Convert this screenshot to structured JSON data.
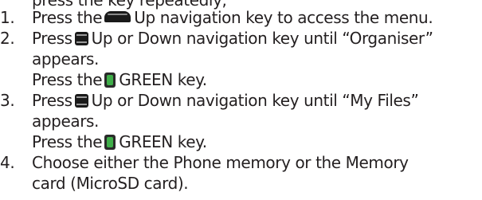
{
  "cut_off_line": "press the key repeatedly,",
  "steps": [
    {
      "number": "1.",
      "lines": [
        {
          "before": "Press the",
          "key": "up-key",
          "after": "Up navigation key to access the menu."
        }
      ]
    },
    {
      "number": "2.",
      "lines": [
        {
          "before": "Press",
          "key": "nav-key",
          "after": "Up or Down navigation key until “Organiser”"
        },
        {
          "text": "appears."
        },
        {
          "before": "Press the",
          "key": "green-key",
          "after": "GREEN key."
        }
      ]
    },
    {
      "number": "3.",
      "lines": [
        {
          "before": "Press",
          "key": "nav-key",
          "after": "Up or Down navigation key until “My Files”"
        },
        {
          "text": "appears."
        },
        {
          "before": "Press the",
          "key": "green-key",
          "after": "GREEN key."
        }
      ]
    },
    {
      "number": "4.",
      "lines": [
        {
          "text": "Choose either the Phone memory or the Memory"
        },
        {
          "text": "card (MicroSD card)."
        }
      ]
    }
  ]
}
